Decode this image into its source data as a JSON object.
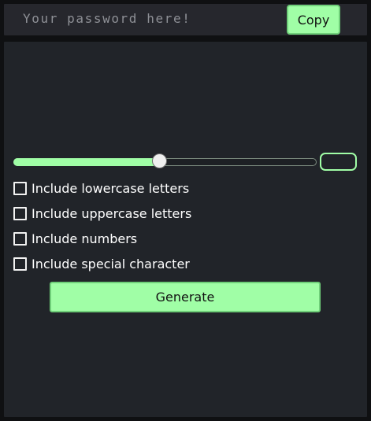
{
  "header": {
    "password_placeholder": "Your password here!",
    "copy_label": "Copy"
  },
  "generator": {
    "length_slider": {
      "value_fraction": 0.48
    },
    "length_value": "",
    "options": [
      {
        "label": "Include lowercase letters",
        "checked": false
      },
      {
        "label": "Include uppercase letters",
        "checked": false
      },
      {
        "label": "Include numbers",
        "checked": false
      },
      {
        "label": "Include special character",
        "checked": false
      }
    ],
    "generate_label": "Generate"
  },
  "colors": {
    "accent": "#a0fea6",
    "panel": "#212429",
    "topbar": "#26272d",
    "background": "#0f1012"
  }
}
